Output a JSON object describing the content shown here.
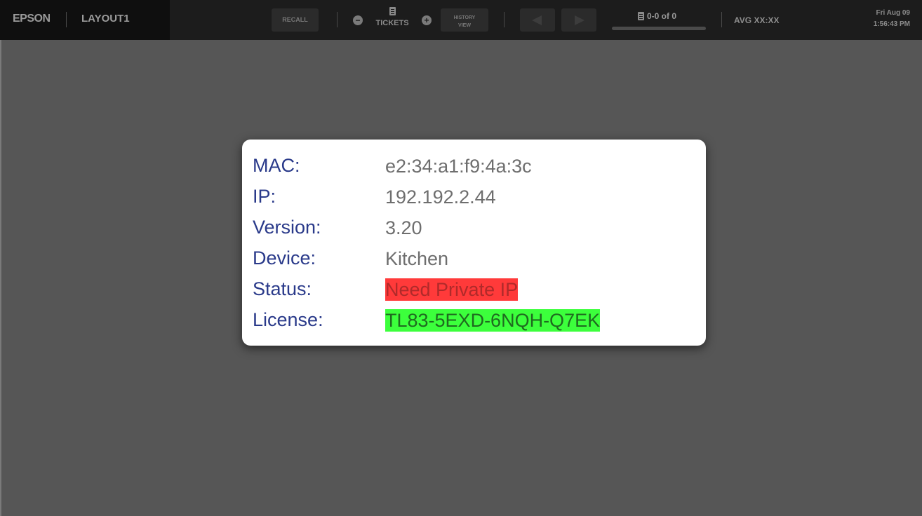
{
  "topbar": {
    "brand": "EPSON",
    "layout_name": "LAYOUT1",
    "recall_label": "RECALL",
    "tickets_label": "TICKETS",
    "history_line1": "HISTORY",
    "history_line2": "VIEW",
    "pager_text": "0-0 of 0",
    "avg_label": "AVG XX:XX",
    "date": "Fri Aug 09",
    "time": "1:56:43 PM"
  },
  "icons": {
    "minus": "minus-circle-icon",
    "plus": "plus-circle-icon",
    "tickets": "document-icon",
    "prev": "triangle-left-icon",
    "next": "triangle-right-icon"
  },
  "colors": {
    "label": "#2a3a8a",
    "status_bg": "#ff3a3a",
    "license_bg": "#3cff3c"
  },
  "info": {
    "mac_label": "MAC:",
    "mac_value": "e2:34:a1:f9:4a:3c",
    "ip_label": "IP:",
    "ip_value": "192.192.2.44",
    "version_label": "Version:",
    "version_value": "3.20",
    "device_label": "Device:",
    "device_value": "Kitchen",
    "status_label": "Status:",
    "status_value": "Need Private IP",
    "license_label": "License:",
    "license_value": "TL83-5EXD-6NQH-Q7EK"
  }
}
